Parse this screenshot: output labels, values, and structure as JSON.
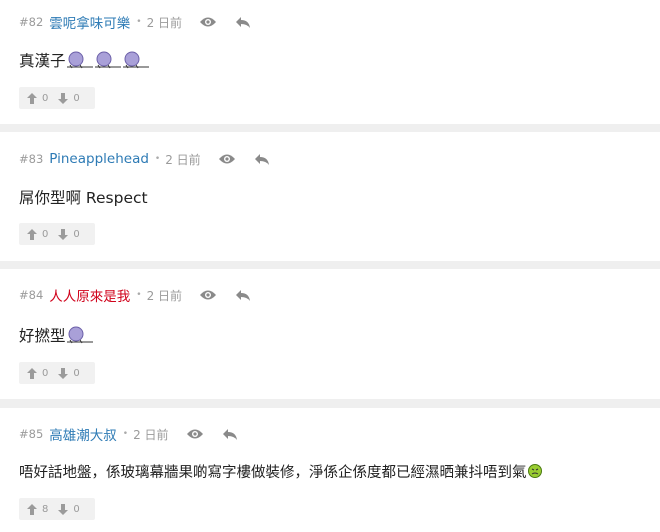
{
  "posts": [
    {
      "number": "#82",
      "username": "雲呢拿味可樂",
      "username_color": "#2e7bb5",
      "dot": "•",
      "time": "2 日前",
      "content": "真漢子",
      "emoticons": [
        "dead-emoticon",
        "dead-emoticon",
        "dead-emoticon"
      ],
      "upvotes": "0",
      "downvotes": "0"
    },
    {
      "number": "#83",
      "username": "Pineapplehead",
      "username_color": "#2e7bb5",
      "dot": "•",
      "time": "2 日前",
      "content": "屌你型啊 Respect",
      "emoticons": [],
      "upvotes": "0",
      "downvotes": "0"
    },
    {
      "number": "#84",
      "username": "人人原來是我",
      "username_color": "#d0021b",
      "dot": "•",
      "time": "2 日前",
      "content": "好撚型",
      "emoticons": [
        "dead-emoticon"
      ],
      "upvotes": "0",
      "downvotes": "0"
    },
    {
      "number": "#85",
      "username": "高雄潮大叔",
      "username_color": "#2e7bb5",
      "dot": "•",
      "time": "2 日前",
      "content": "唔好話地盤，係玻璃幕牆果啲寫字樓做裝修，淨係企係度都已經濕晒兼抖唔到氣",
      "emoticons": [
        "sick-emoticon"
      ],
      "upvotes": "8",
      "downvotes": "0"
    }
  ],
  "icons": {
    "view": "eye-icon",
    "reply": "reply-icon",
    "upvote": "arrow-up-icon",
    "downvote": "arrow-down-icon"
  }
}
